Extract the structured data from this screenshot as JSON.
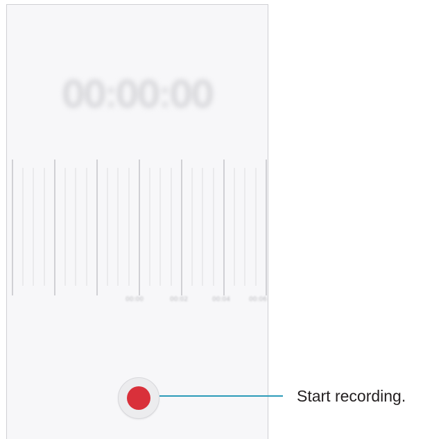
{
  "screen": {
    "timer_text": "00:00:00",
    "timeline_labels": [
      "00:00",
      "00:02",
      "00:04",
      "00:06"
    ],
    "record_button": {
      "icon": "record-dot-icon",
      "color": "#d9303a"
    }
  },
  "callout": {
    "text": "Start recording.",
    "line_color": "#2a9ab8"
  }
}
